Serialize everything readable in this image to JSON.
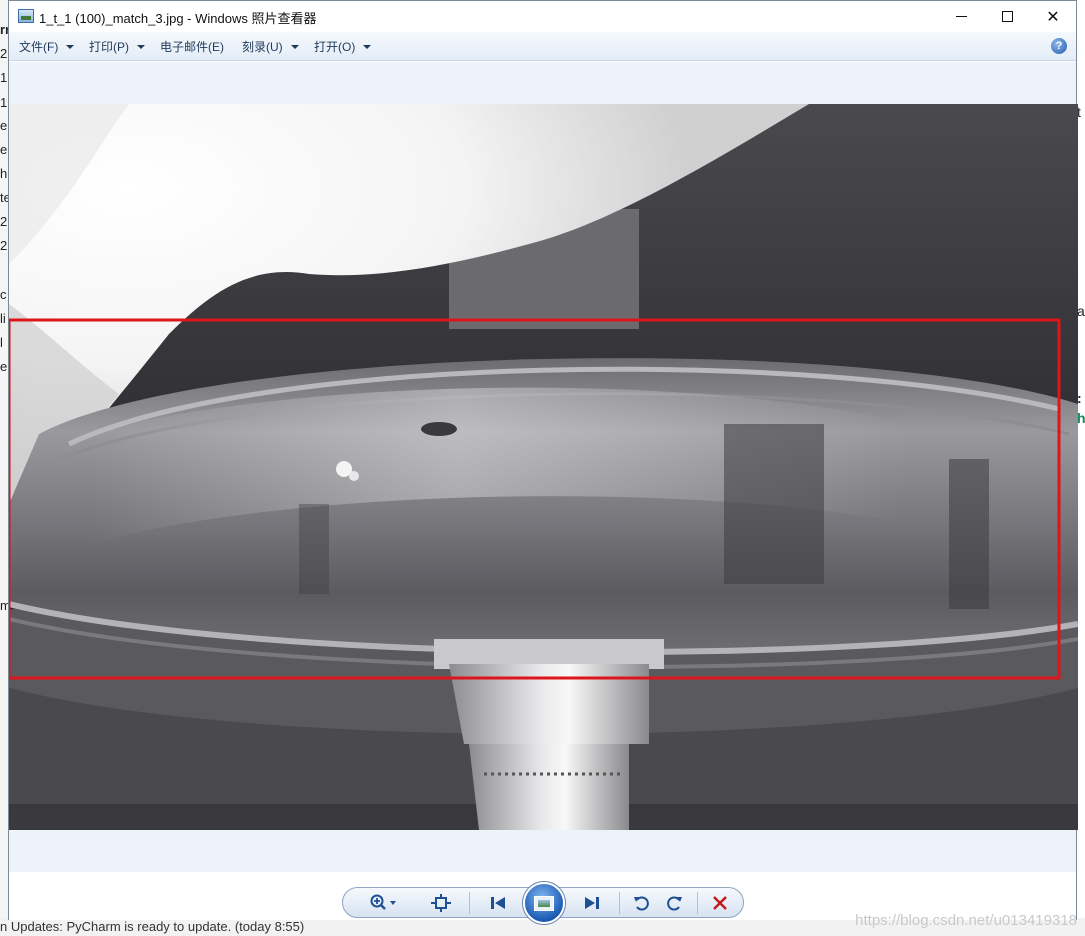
{
  "background_app": {
    "left_chars": [
      "rr",
      "2",
      "1",
      "1",
      "e",
      "e",
      "h",
      "te",
      "2",
      "2",
      "c",
      "li",
      "l",
      "e",
      "m"
    ],
    "right_chars": [
      "t",
      "a",
      ":",
      "h"
    ],
    "status_text": "n Updates: PyCharm is ready to update. (today 8:55)"
  },
  "window": {
    "title": "1_t_1 (100)_match_3.jpg - Windows 照片查看器",
    "minimize": "—",
    "close": "✕"
  },
  "menu": {
    "items": [
      {
        "label": "文件(F)",
        "has_arrow": true
      },
      {
        "label": "打印(P)",
        "has_arrow": true
      },
      {
        "label": "电子邮件(E)",
        "has_arrow": false
      },
      {
        "label": "刻录(U)",
        "has_arrow": true
      },
      {
        "label": "打开(O)",
        "has_arrow": true
      }
    ],
    "help": "?"
  },
  "image": {
    "description_alt": "1_t_1 (100)_match_3.jpg",
    "annotation_color": "#e0141b"
  },
  "toolbar": {
    "zoom_icon": "zoom-icon",
    "fit_icon": "actual-size-icon",
    "prev_icon": "previous-icon",
    "slideshow_icon": "slideshow-icon",
    "next_icon": "next-icon",
    "rotate_ccw_icon": "rotate-counterclockwise-icon",
    "rotate_cw_icon": "rotate-clockwise-icon",
    "delete_icon": "delete-icon"
  },
  "watermark": "https://blog.csdn.net/u013419318"
}
